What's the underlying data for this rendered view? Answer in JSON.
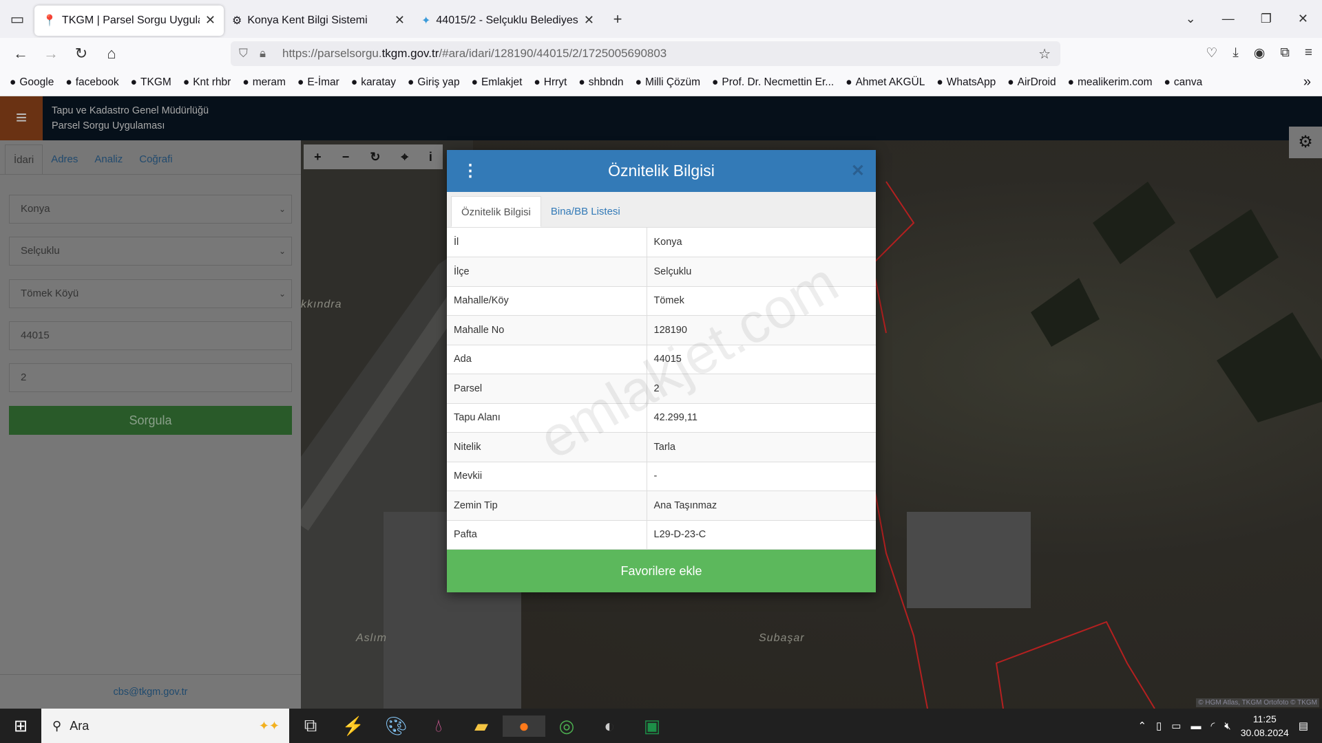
{
  "browser": {
    "tabs": [
      {
        "title": "TKGM | Parsel Sorgu Uygulaması",
        "icon": "map-pin-icon"
      },
      {
        "title": "Konya Kent Bilgi Sistemi",
        "icon": "emblem-icon"
      },
      {
        "title": "44015/2 - Selçuklu Belediyesi - ",
        "icon": "star-icon"
      }
    ],
    "url_prefix": "https://parselsorgu.",
    "url_domain": "tkgm.gov.tr",
    "url_suffix": "/#ara/idari/128190/44015/2/1725005690803",
    "bookmarks": [
      "Google",
      "facebook",
      "TKGM",
      "Knt rhbr",
      "meram",
      "E-İmar",
      "karatay",
      "Giriş yap",
      "Emlakjet",
      "Hrryt",
      "shbndn",
      "Milli Çözüm",
      "Prof. Dr. Necmettin Er...",
      "Ahmet AKGÜL",
      "WhatsApp",
      "AirDroid",
      "mealikerim.com",
      "canva"
    ]
  },
  "app": {
    "header_line1": "Tapu ve Kadastro Genel Müdürlüğü",
    "header_line2": "Parsel Sorgu Uygulaması",
    "tabs": [
      "İdari",
      "Adres",
      "Analiz",
      "Coğrafi"
    ],
    "il": "Konya",
    "ilce": "Selçuklu",
    "mahalle": "Tömek Köyü",
    "ada": "44015",
    "parsel": "2",
    "submit": "Sorgula",
    "footer_email": "cbs@tkgm.gov.tr",
    "map_labels": [
      "kkındra",
      "Aslım",
      "Subaşar"
    ],
    "attribution": "© HGM Atlas, TKGM Ortofoto © TKGM",
    "accent": "#337ab7",
    "success": "#5cb85c",
    "parcel_line": "#d42020"
  },
  "dialog": {
    "title": "Öznitelik Bilgisi",
    "tabs": [
      "Öznitelik Bilgisi",
      "Bina/BB Listesi"
    ],
    "rows": [
      [
        "İl",
        "Konya"
      ],
      [
        "İlçe",
        "Selçuklu"
      ],
      [
        "Mahalle/Köy",
        "Tömek"
      ],
      [
        "Mahalle No",
        "128190"
      ],
      [
        "Ada",
        "44015"
      ],
      [
        "Parsel",
        "2"
      ],
      [
        "Tapu Alanı",
        "42.299,11"
      ],
      [
        "Nitelik",
        "Tarla"
      ],
      [
        "Mevkii",
        "-"
      ],
      [
        "Zemin Tip",
        "Ana Taşınmaz"
      ],
      [
        "Pafta",
        "L29-D-23-C"
      ]
    ],
    "favorite_button": "Favorilere ekle",
    "watermark": "emlakjet.com"
  },
  "taskbar": {
    "search": "Ara",
    "time": "11:25",
    "date": "30.08.2024"
  }
}
